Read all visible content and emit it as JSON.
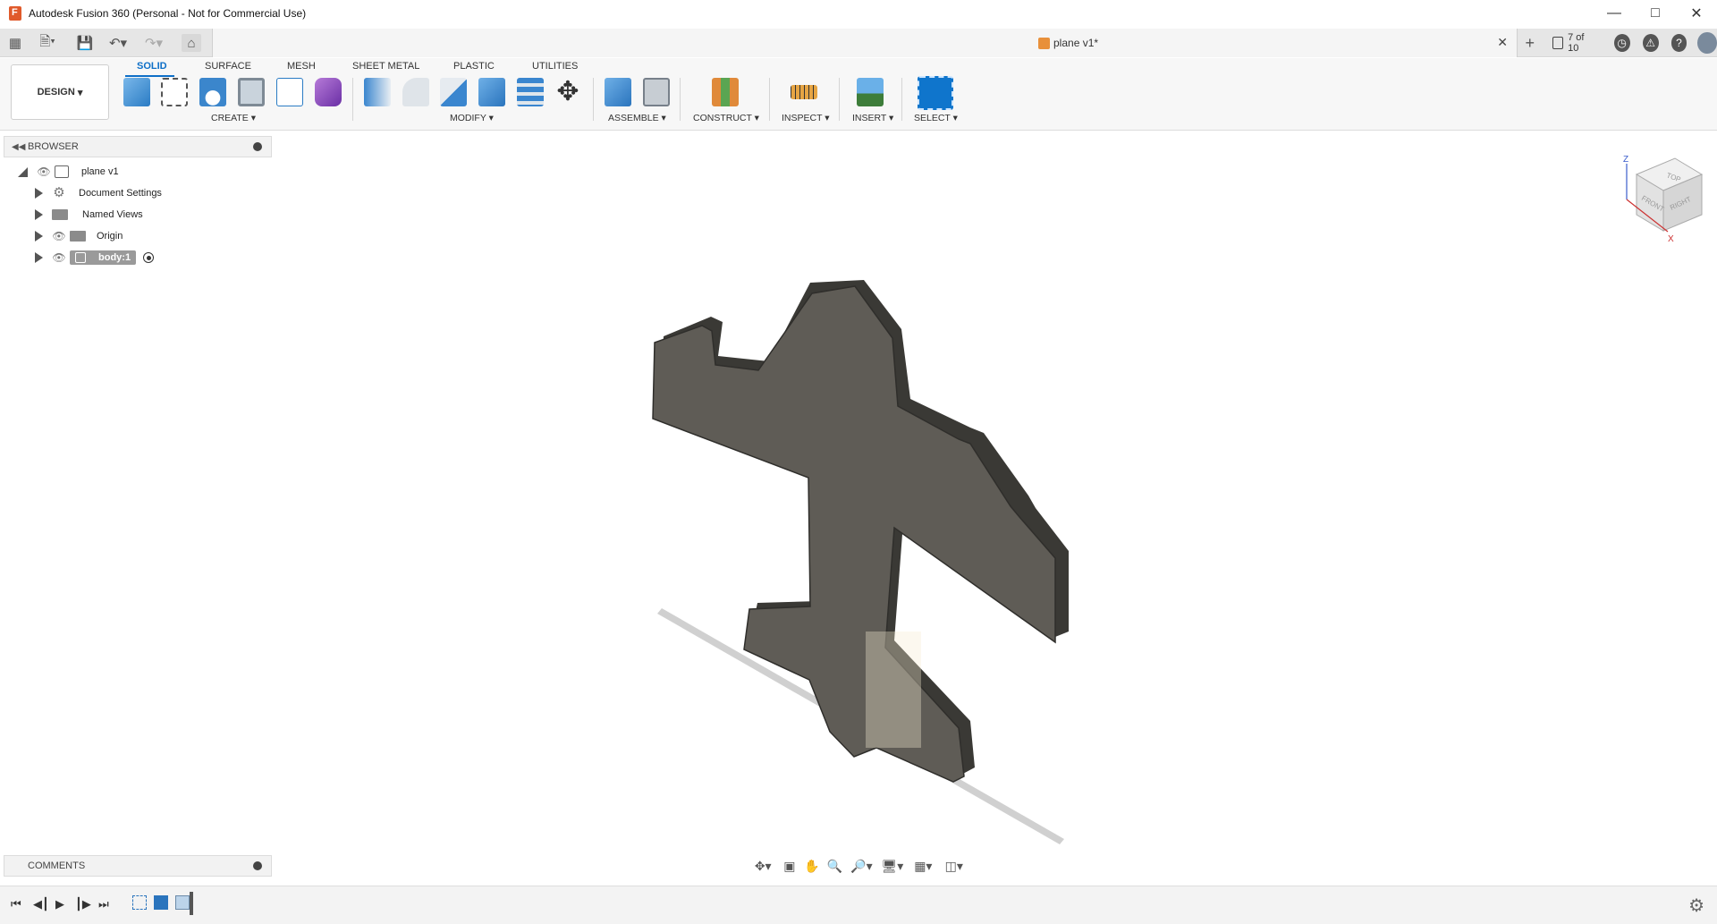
{
  "window": {
    "title": "Autodesk Fusion 360 (Personal - Not for Commercial Use)",
    "controls": [
      "minimize",
      "maximize",
      "close"
    ]
  },
  "tabstrip": {
    "doc_title": "plane v1*",
    "job_count": "7 of 10"
  },
  "ribbon": {
    "workspace": "DESIGN",
    "tabs": [
      "SOLID",
      "SURFACE",
      "MESH",
      "SHEET METAL",
      "PLASTIC",
      "UTILITIES"
    ],
    "active_tab": "SOLID",
    "groups": [
      "CREATE",
      "MODIFY",
      "ASSEMBLE",
      "CONSTRUCT",
      "INSPECT",
      "INSERT",
      "SELECT"
    ]
  },
  "browser": {
    "label": "BROWSER",
    "items": [
      {
        "label": "plane v1"
      },
      {
        "label": "Document Settings"
      },
      {
        "label": "Named Views"
      },
      {
        "label": "Origin"
      },
      {
        "label": "body:1"
      }
    ]
  },
  "comments": {
    "label": "COMMENTS"
  },
  "viewcube": {
    "faces": [
      "TOP",
      "FRONT",
      "RIGHT"
    ],
    "axes": [
      "Z",
      "X"
    ]
  },
  "icons": {
    "quick_access": [
      "grid-icon",
      "file-icon",
      "save-icon",
      "undo-icon",
      "redo-icon",
      "home-icon"
    ],
    "nav": [
      "orbit-icon",
      "look-at-icon",
      "pan-icon",
      "zoom-icon",
      "fit-icon",
      "display-settings-icon",
      "grid-settings-icon",
      "viewports-icon"
    ],
    "timeline": [
      "first-icon",
      "prev-icon",
      "play-icon",
      "next-icon",
      "last-icon"
    ]
  },
  "colors": {
    "accent": "#0e6fc7",
    "model": "#5f5c56",
    "model_edge": "#3a3935"
  }
}
